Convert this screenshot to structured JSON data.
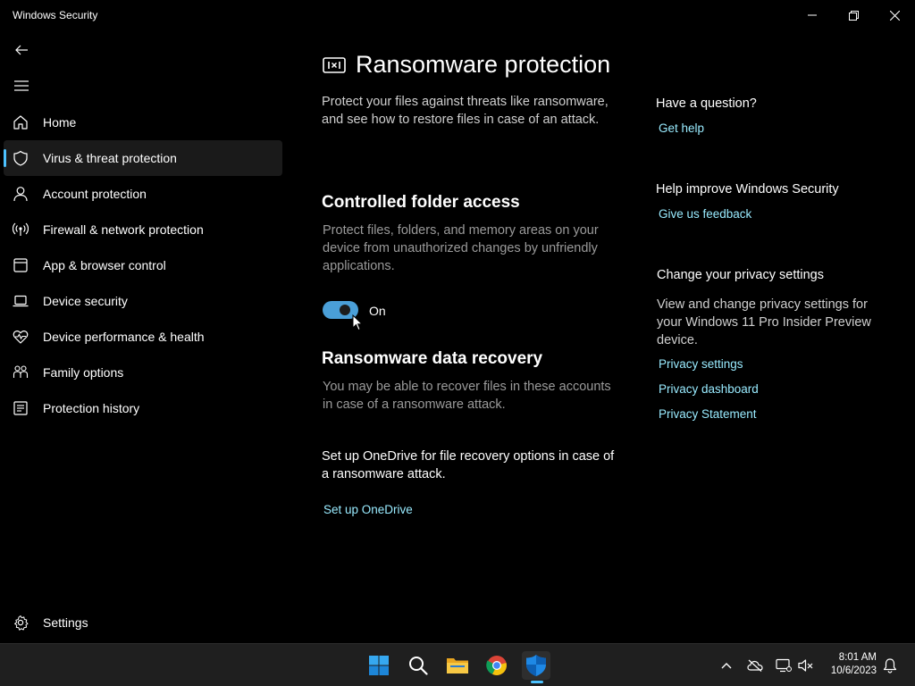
{
  "window": {
    "title": "Windows Security"
  },
  "nav": {
    "items": [
      {
        "label": "Home",
        "icon": "home-icon"
      },
      {
        "label": "Virus & threat protection",
        "icon": "shield-icon",
        "active": true
      },
      {
        "label": "Account protection",
        "icon": "person-icon"
      },
      {
        "label": "Firewall & network protection",
        "icon": "wireless-icon"
      },
      {
        "label": "App & browser control",
        "icon": "browser-window-icon"
      },
      {
        "label": "Device security",
        "icon": "laptop-icon"
      },
      {
        "label": "Device performance & health",
        "icon": "heart-pulse-icon"
      },
      {
        "label": "Family options",
        "icon": "family-icon"
      },
      {
        "label": "Protection history",
        "icon": "history-icon"
      }
    ],
    "settings_label": "Settings"
  },
  "main": {
    "title": "Ransomware protection",
    "description": "Protect your files against threats like ransomware, and see how to restore files in case of an attack.",
    "cfa": {
      "heading": "Controlled folder access",
      "description": "Protect files, folders, and memory areas on your device from unauthorized changes by unfriendly applications.",
      "toggle_state": "On"
    },
    "recovery": {
      "heading": "Ransomware data recovery",
      "description": "You may be able to recover files in these accounts in case of a ransomware attack.",
      "onedrive_text": "Set up OneDrive for file recovery options in case of a ransomware attack.",
      "onedrive_link": "Set up OneDrive"
    }
  },
  "side": {
    "question": {
      "heading": "Have a question?",
      "link": "Get help"
    },
    "improve": {
      "heading": "Help improve Windows Security",
      "link": "Give us feedback"
    },
    "privacy": {
      "heading": "Change your privacy settings",
      "description": "View and change privacy settings for your Windows 11 Pro Insider Preview device.",
      "links": [
        "Privacy settings",
        "Privacy dashboard",
        "Privacy Statement"
      ]
    }
  },
  "taskbar": {
    "time": "8:01 AM",
    "date": "10/6/2023"
  },
  "colors": {
    "accent": "#4cc2ff",
    "link": "#99ebff",
    "toggle_on": "#4a9fd8"
  }
}
